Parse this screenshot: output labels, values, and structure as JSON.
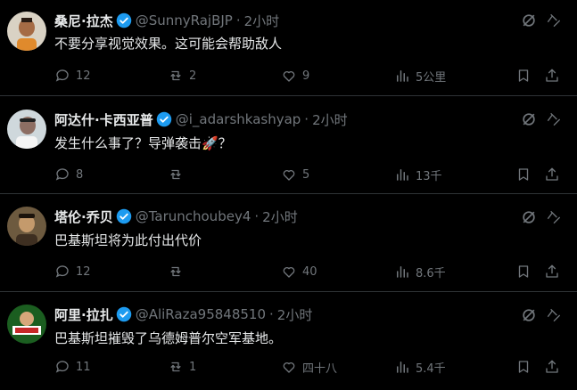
{
  "tweets": [
    {
      "name": "桑尼·拉杰",
      "handle": "@SunnyRajBJP",
      "time": "2小时",
      "text": "不要分享视觉效果。这可能会帮助敌人",
      "replies": "12",
      "retweets": "2",
      "likes": "9",
      "views": "5公里"
    },
    {
      "name": "阿达什·卡西亚普",
      "handle": "@i_adarshkashyap",
      "time": "2小时",
      "text": "发生什么事了？导弹袭击🚀？",
      "replies": "8",
      "retweets": "",
      "likes": "5",
      "views": "13千"
    },
    {
      "name": "塔伦·乔贝",
      "handle": "@Tarunchoubey4",
      "time": "2小时",
      "text": "巴基斯坦将为此付出代价",
      "replies": "12",
      "retweets": "",
      "likes": "40",
      "views": "8.6千"
    },
    {
      "name": "阿里·拉扎",
      "handle": "@AliRaza95848510",
      "time": "2小时",
      "text": "巴基斯坦摧毁了乌德姆普尔空军基地。",
      "replies": "11",
      "retweets": "1",
      "likes": "四十八",
      "views": "5.4千"
    }
  ],
  "colors": {
    "background": "#000000",
    "text": "#e7e9ea",
    "muted": "#71767b",
    "verified": "#1d9bf0",
    "divider": "#2f3336"
  },
  "icons": [
    "reply-icon",
    "retweet-icon",
    "like-icon",
    "views-icon",
    "bookmark-icon",
    "share-icon",
    "grok-icon",
    "more-icon",
    "verified-icon"
  ]
}
